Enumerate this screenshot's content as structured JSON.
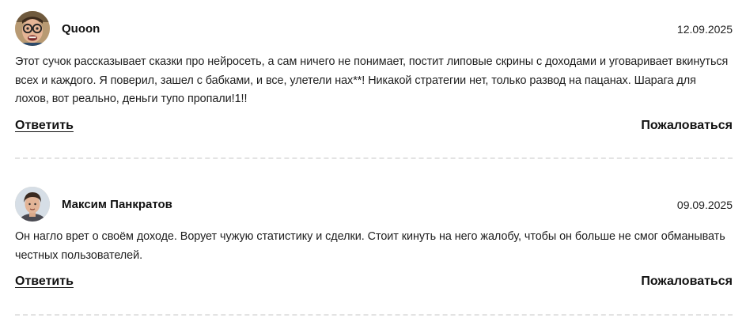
{
  "comments": [
    {
      "author": "Quoon",
      "date": "12.09.2025",
      "text": "Этот сучок рассказывает сказки про нейросеть, а сам ничего не понимает, постит липовые скрины с доходами и уговаривает вкинуться всех и каждого. Я поверил, зашел с бабками, и все, улетели нах**! Никакой стратегии нет, только развод на пацанах. Шарага для лохов, вот реально, деньги тупо пропали!1!!",
      "reply_label": "Ответить",
      "report_label": "Пожаловаться",
      "avatar_icon": "user-avatar-photo"
    },
    {
      "author": "Максим Панкратов",
      "date": "09.09.2025",
      "text": "Он нагло врет о своём доходе. Ворует чужую статистику и сделки. Стоит кинуть на него жалобу, чтобы он больше не смог обманывать честных пользователей.",
      "reply_label": "Ответить",
      "report_label": "Пожаловаться",
      "avatar_icon": "user-avatar-photo"
    }
  ]
}
